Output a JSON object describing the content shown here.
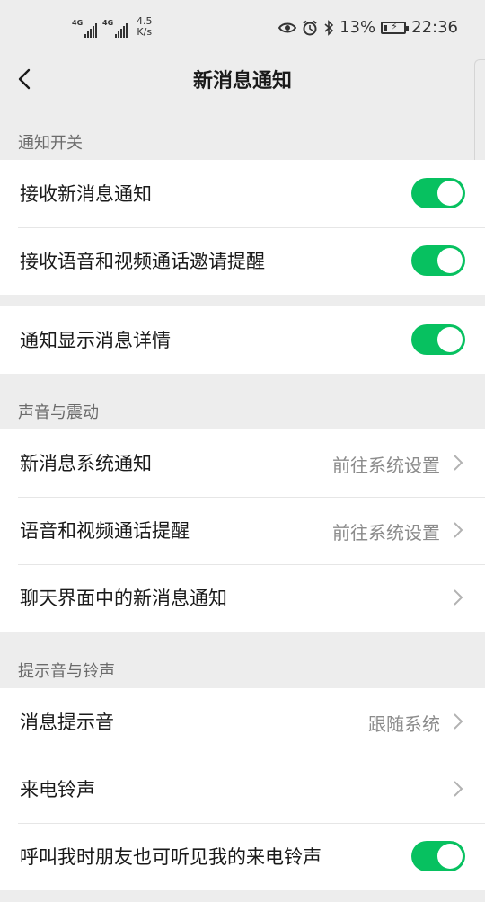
{
  "status_bar": {
    "signal_1_type": "4G",
    "signal_2_type": "4G",
    "net_speed_value": "4.5",
    "net_speed_unit": "K/s",
    "battery_percent": "13%",
    "time": "22:36"
  },
  "nav": {
    "title": "新消息通知"
  },
  "sections": {
    "notify_switch": {
      "header": "通知开关",
      "receive_new_message": "接收新消息通知",
      "receive_call_invites": "接收语音和视频通话邀请提醒",
      "show_message_details": "通知显示消息详情"
    },
    "sound_vibration": {
      "header": "声音与震动",
      "system_notify_label": "新消息系统通知",
      "system_notify_value": "前往系统设置",
      "call_remind_label": "语音和视频通话提醒",
      "call_remind_value": "前往系统设置",
      "chat_notify_label": "聊天界面中的新消息通知"
    },
    "tones": {
      "header": "提示音与铃声",
      "message_tone_label": "消息提示音",
      "message_tone_value": "跟随系统",
      "ringtone_label": "来电铃声",
      "friends_hear_ringtone_label": "呼叫我时朋友也可听见我的来电铃声"
    }
  },
  "toggles": {
    "receive_new_message": true,
    "receive_call_invites": true,
    "show_message_details": true,
    "friends_hear_ringtone": true
  },
  "colors": {
    "accent": "#07c160",
    "background": "#ededed"
  }
}
